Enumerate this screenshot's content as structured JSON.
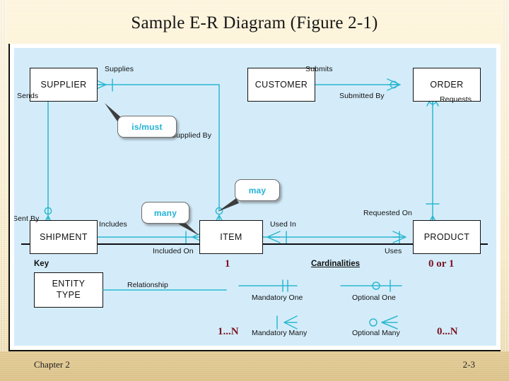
{
  "slide": {
    "title": "Sample E-R Diagram (Figure 2-1)",
    "footer_left": "Chapter 2",
    "footer_right": "2-3"
  },
  "colors": {
    "panel_bg": "#d4ecfa",
    "connector": "#2bb8cf",
    "entity_border": "#111111",
    "callout_text": "#23b2d6",
    "annotation": "#7d1420",
    "slide_bg": "#fbecc6",
    "footer_bg": "#dfc68c"
  },
  "diagram": {
    "entities": [
      {
        "name": "SUPPLIER",
        "label": "SUPPLIER"
      },
      {
        "name": "CUSTOMER",
        "label": "CUSTOMER"
      },
      {
        "name": "ORDER",
        "label": "ORDER"
      },
      {
        "name": "SHIPMENT",
        "label": "SHIPMENT"
      },
      {
        "name": "ITEM",
        "label": "ITEM"
      },
      {
        "name": "PRODUCT",
        "label": "PRODUCT"
      }
    ],
    "relationship_labels": [
      {
        "name": "supplies",
        "text": "Supplies"
      },
      {
        "name": "supplied-by",
        "text": "Supplied By"
      },
      {
        "name": "sends",
        "text": "Sends"
      },
      {
        "name": "sent-by",
        "text": "Sent By"
      },
      {
        "name": "includes",
        "text": "Includes"
      },
      {
        "name": "included-on",
        "text": "Included On"
      },
      {
        "name": "submits",
        "text": "Submits"
      },
      {
        "name": "submitted-by",
        "text": "Submitted By"
      },
      {
        "name": "requests",
        "text": "Requests"
      },
      {
        "name": "requested-on",
        "text": "Requested On"
      },
      {
        "name": "used-in",
        "text": "Used In"
      },
      {
        "name": "uses",
        "text": "Uses"
      }
    ],
    "callouts": [
      {
        "name": "is-must",
        "text": "is/must"
      },
      {
        "name": "may",
        "text": "may"
      },
      {
        "name": "many",
        "text": "many"
      }
    ]
  },
  "legend": {
    "key_title": "Key",
    "entity_type_line1": "ENTITY",
    "entity_type_line2": "TYPE",
    "relationship_label": "Relationship",
    "cardinalities_title": "Cardinalities",
    "cardinalities": [
      {
        "name": "mandatory-one",
        "label": "Mandatory One"
      },
      {
        "name": "optional-one",
        "label": "Optional One"
      },
      {
        "name": "mandatory-many",
        "label": "Mandatory Many"
      },
      {
        "name": "optional-many",
        "label": "Optional Many"
      }
    ]
  },
  "annotations": [
    {
      "name": "annot-one",
      "text": "1"
    },
    {
      "name": "annot-zero-or-one",
      "text": "0 or 1"
    },
    {
      "name": "annot-one-to-n",
      "text": "1...N"
    },
    {
      "name": "annot-zero-to-n",
      "text": "0...N"
    }
  ]
}
